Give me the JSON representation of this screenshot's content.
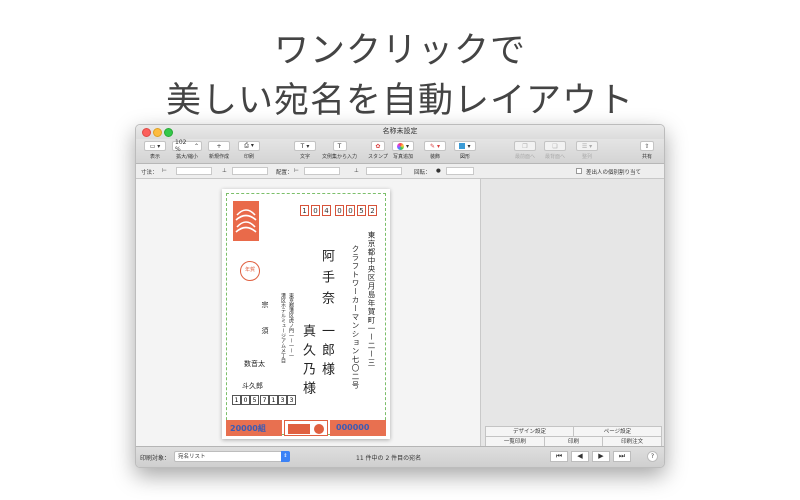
{
  "headline": {
    "line1": "ワンクリックで",
    "line2": "美しい宛名を自動レイアウト"
  },
  "window": {
    "title": "名称未設定"
  },
  "toolbar": {
    "view": {
      "label": "表示"
    },
    "zoom": {
      "label": "拡大/縮小",
      "value": "102 %"
    },
    "new_create": {
      "label": "新規作成",
      "symbol": "+"
    },
    "print": {
      "label": "印刷"
    },
    "text": {
      "label": "文字",
      "symbol": "T"
    },
    "text_from_example": {
      "label": "文例集から入力",
      "symbol": "T"
    },
    "stamp": {
      "label": "スタンプ"
    },
    "photo": {
      "label": "写真追加"
    },
    "color": {
      "label": "装飾"
    },
    "shape": {
      "label": "図形"
    },
    "bring_front": {
      "label": "最前面へ"
    },
    "send_back": {
      "label": "最背面へ"
    },
    "align": {
      "label": "整列"
    },
    "share": {
      "label": "共有"
    }
  },
  "format_bar": {
    "size_label": "寸法：",
    "position_label": "配置：",
    "rotation_label": "回転：",
    "individual_label": "差出人の個別割り当て"
  },
  "right_panel": {
    "design_settings": "デザイン設定",
    "page_settings": "ページ設定",
    "print_list": "一覧印刷",
    "print": "印刷",
    "print_order": "印刷注文"
  },
  "bottom": {
    "target_label": "印刷対象：",
    "target_value": "宛名リスト",
    "status": "11 件中の 2 件目の宛名",
    "nav": [
      "⏮",
      "◀",
      "▶",
      "⏭"
    ],
    "help": "?"
  },
  "card": {
    "zip": [
      "1",
      "0",
      "4",
      "0",
      "0",
      "5",
      "2"
    ],
    "address": "東京都中央区月島年賀町一ー二ー三",
    "building": "クラフトワーカーマンション七〇二号",
    "name_main_family": "阿手奈",
    "name_main_given": "一郎様",
    "name_sub_given": "真久乃様",
    "seal_text": "年賀",
    "sender_address": "東京都港区虎ノ門一ー一ー一",
    "sender_building": "港区ホテルミュージアムメ丁目",
    "sender_name_a": "宗",
    "sender_name_b": "須",
    "sender_name_c": "数音太",
    "sender_name_d": "斗久郎",
    "sender_zip": [
      "1",
      "0",
      "5",
      "7",
      "1",
      "3",
      "3"
    ],
    "lottery_left": "20000組",
    "lottery_right": "000000"
  },
  "colors": {
    "accent": "#3b82f6",
    "stamp": "#e96a4a",
    "guide": "#7cbf6a"
  }
}
